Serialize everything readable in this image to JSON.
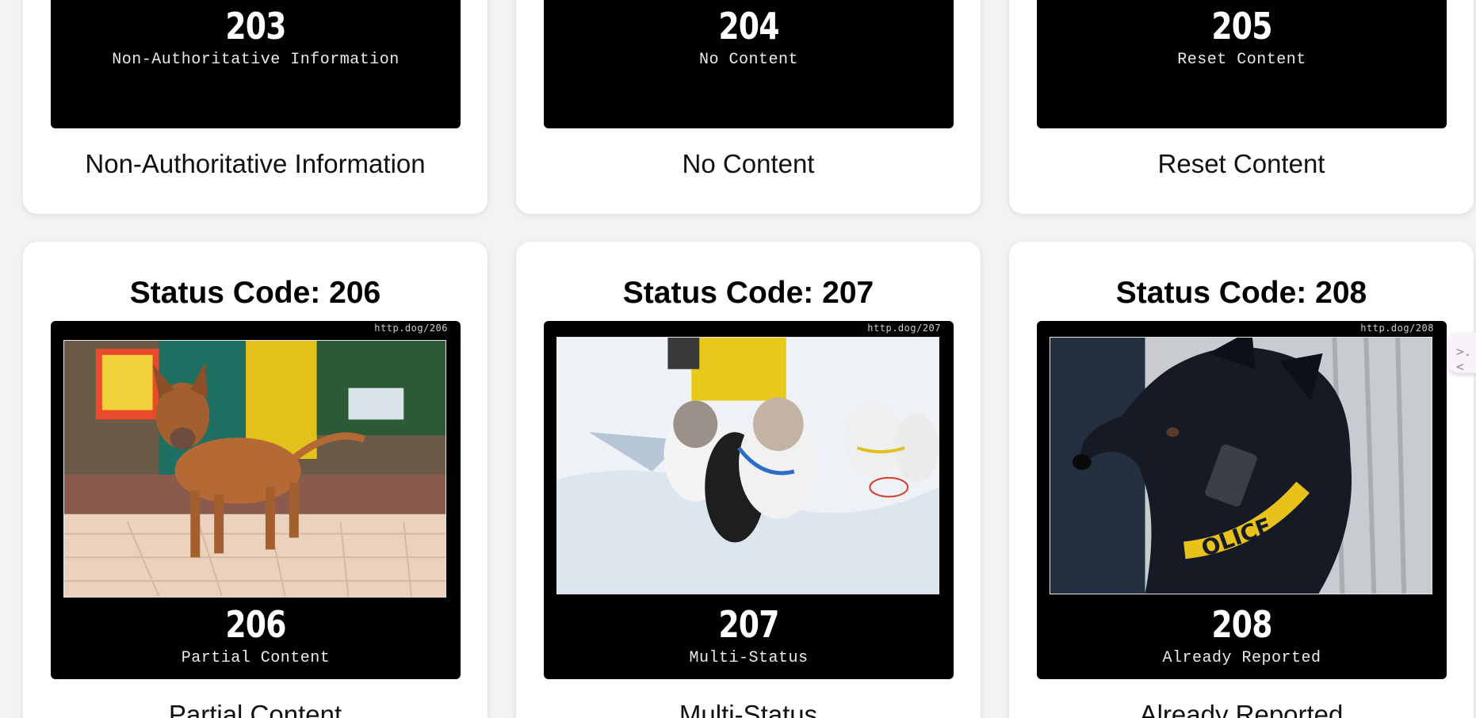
{
  "top_row": [
    {
      "code": "203",
      "status_text": "Non-Authoritative Information",
      "caption": "Non-Authoritative Information"
    },
    {
      "code": "204",
      "status_text": "No Content",
      "caption": "No Content"
    },
    {
      "code": "205",
      "status_text": "Reset Content",
      "caption": "Reset Content"
    }
  ],
  "bottom_row": [
    {
      "title": "Status Code: 206",
      "url": "http.dog/206",
      "code": "206",
      "status_text": "Partial Content",
      "caption": "Partial Content"
    },
    {
      "title": "Status Code: 207",
      "url": "http.dog/207",
      "code": "207",
      "status_text": "Multi-Status",
      "caption": "Multi-Status"
    },
    {
      "title": "Status Code: 208",
      "url": "http.dog/208",
      "code": "208",
      "status_text": "Already Reported",
      "caption": "Already Reported"
    }
  ],
  "side_tab": {
    "icon": "code-chevron-icon",
    "glyph": ">.<"
  },
  "colors": {
    "page_bg": "#f3f3f3",
    "card_bg": "#ffffff",
    "poster_bg": "#000000",
    "collar_yellow": "#e8c21a"
  }
}
